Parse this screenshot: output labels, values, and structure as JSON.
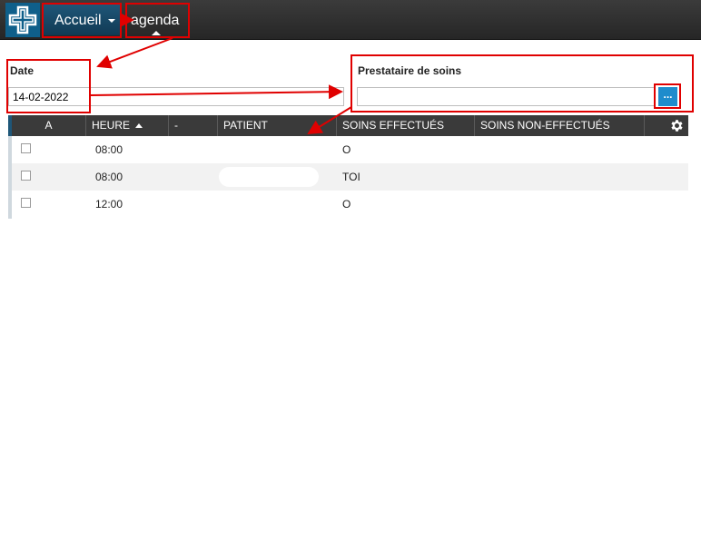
{
  "nav": {
    "logo_icon": "medical-cross-logo",
    "accueil_label": "Accueil",
    "agenda_label": "agenda"
  },
  "filters": {
    "date_label": "Date",
    "date_value": "14-02-2022",
    "provider_label": "Prestataire de soins",
    "provider_value": "",
    "browse_label": "..."
  },
  "table": {
    "columns": [
      "A",
      "HEURE",
      "-",
      "PATIENT",
      "SOINS EFFECTUÉS",
      "SOINS NON-EFFECTUÉS"
    ],
    "rows": [
      {
        "checked": false,
        "heure": "08:00",
        "dash": "",
        "patient": "",
        "soins_effectues": "O",
        "soins_non_effectues": ""
      },
      {
        "checked": false,
        "heure": "08:00",
        "dash": "",
        "patient": "",
        "soins_effectues": "TOI",
        "soins_non_effectues": ""
      },
      {
        "checked": false,
        "heure": "12:00",
        "dash": "",
        "patient": "",
        "soins_effectues": "O",
        "soins_non_effectues": ""
      }
    ]
  },
  "colors": {
    "topbar": "#2e2e2e",
    "accent": "#1e5678",
    "browse_button": "#1e8ccc",
    "annotation": "#e00000"
  }
}
